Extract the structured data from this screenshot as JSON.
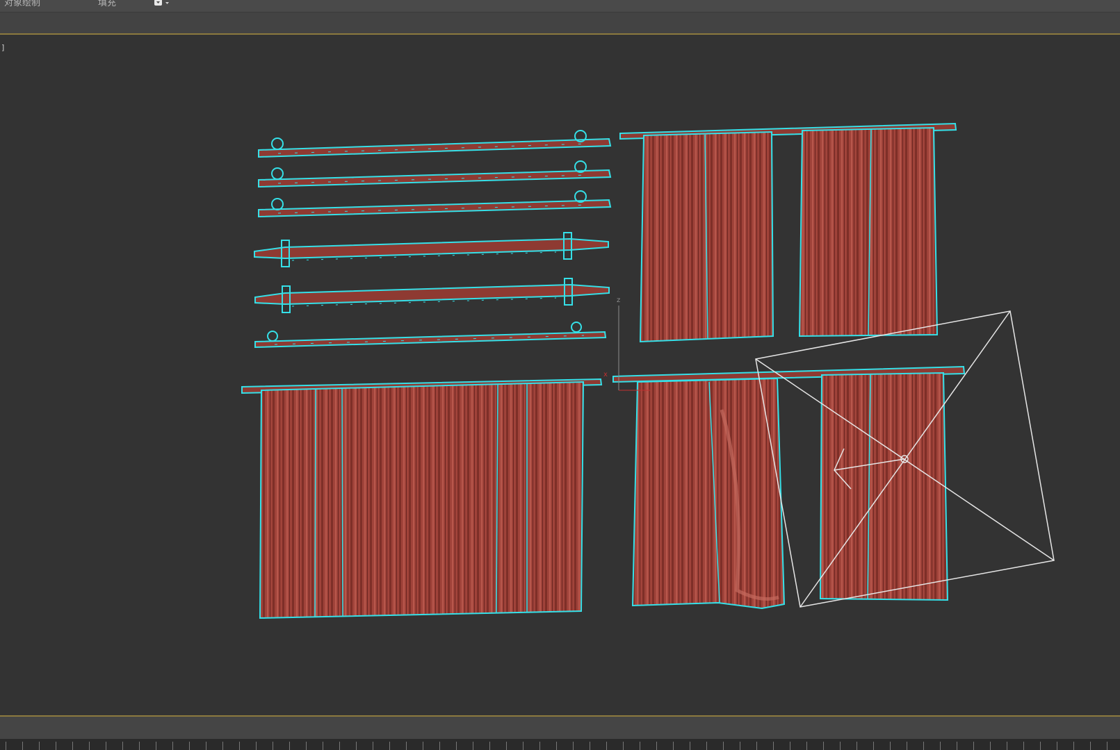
{
  "ribbon": {
    "tab_object_paint": "对象绘制",
    "tab_fill": "填充",
    "dropdown_icon": "paint-bucket-dropdown-icon"
  },
  "viewport": {
    "label": "]",
    "axis_z": "z",
    "axis_x": "x"
  },
  "colors": {
    "viewport_bg": "#333333",
    "selection_outline": "#35e0e8",
    "curtain_fabric": "#a0433a",
    "gizmo_white": "#e6e6e6",
    "ribbon_bg": "#4a4a4a",
    "accent_line": "#8c7a3e"
  },
  "scene_objects": [
    {
      "name": "curtain-rod-1"
    },
    {
      "name": "curtain-rod-2"
    },
    {
      "name": "curtain-rod-3"
    },
    {
      "name": "curtain-rod-4"
    },
    {
      "name": "curtain-rod-5"
    },
    {
      "name": "curtain-rod-6"
    },
    {
      "name": "curtain-set-top-right"
    },
    {
      "name": "curtain-set-bottom-left"
    },
    {
      "name": "curtain-set-bottom-right"
    },
    {
      "name": "light-gizmo"
    }
  ]
}
